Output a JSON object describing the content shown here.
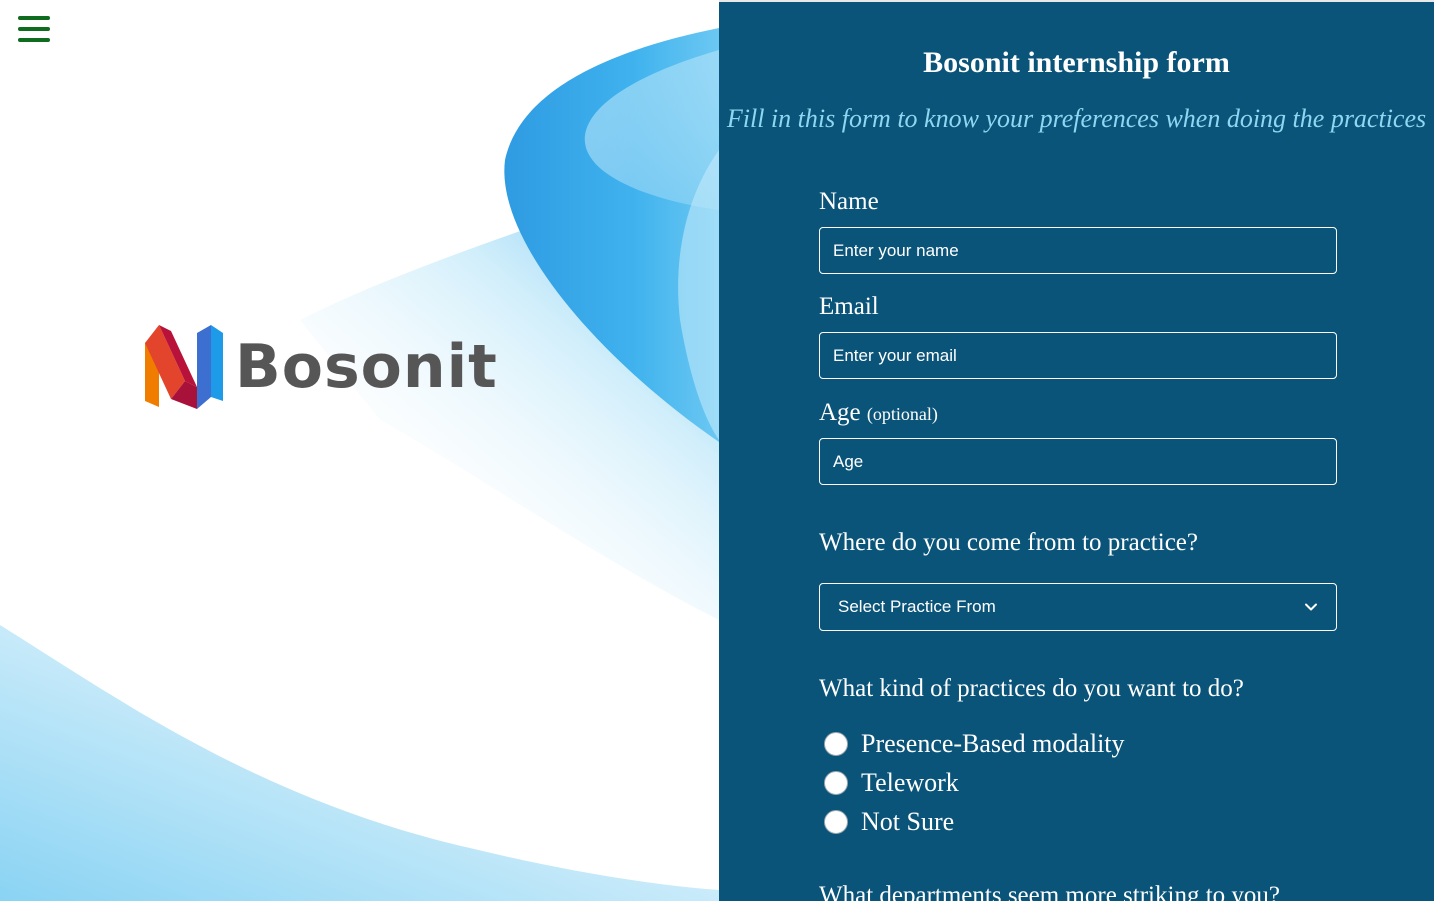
{
  "brand": {
    "name": "Bosonit",
    "logo_colors": [
      "#e2452b",
      "#b8123a",
      "#f07d00",
      "#3d6fd1",
      "#1e9be8"
    ]
  },
  "nav": {
    "menu_icon": "hamburger-menu-icon",
    "menu_color": "#0f6b1d"
  },
  "form": {
    "title": "Bosonit internship form",
    "subtitle": "Fill in this form to know your preferences when doing the practices",
    "background": "#0b5479",
    "accent": "#8fd6f2",
    "fields": {
      "name": {
        "label": "Name",
        "placeholder": "Enter your name",
        "value": ""
      },
      "email": {
        "label": "Email",
        "placeholder": "Enter your email",
        "value": ""
      },
      "age": {
        "label": "Age",
        "label_suffix": "(optional)",
        "placeholder": "Age",
        "value": ""
      }
    },
    "origin": {
      "question": "Where do you come from to practice?",
      "select_value": "Select Practice From",
      "select_icon": "chevron-down-icon"
    },
    "practice_kind": {
      "question": "What kind of practices do you want to do?",
      "options": [
        "Presence-Based modality",
        "Telework",
        "Not Sure"
      ]
    },
    "departments": {
      "question": "What departments seem more striking to you?"
    }
  }
}
